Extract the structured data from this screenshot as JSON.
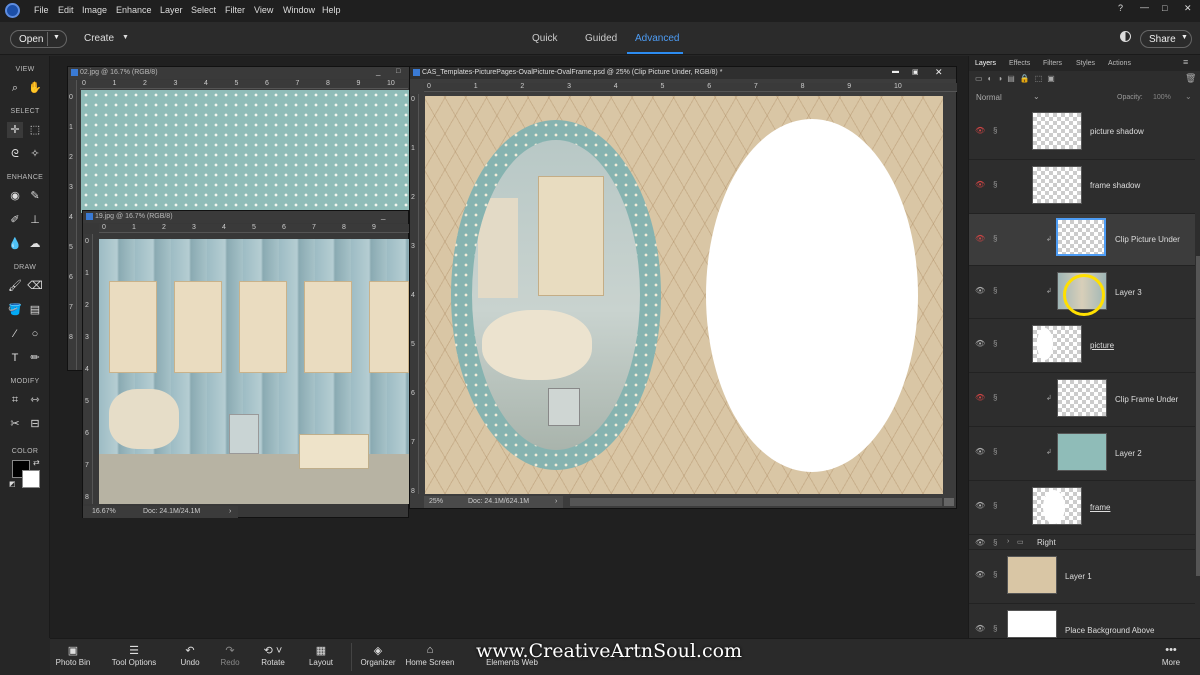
{
  "menubar": {
    "items": [
      "File",
      "Edit",
      "Image",
      "Enhance",
      "Layer",
      "Select",
      "Filter",
      "View",
      "Window",
      "Help"
    ]
  },
  "optbar": {
    "open_label": "Open",
    "create_label": "Create",
    "modes": [
      "Quick",
      "Guided",
      "Advanced"
    ],
    "active_mode": "Advanced",
    "share_label": "Share"
  },
  "toolbox": {
    "sections": [
      "VIEW",
      "SELECT",
      "ENHANCE",
      "DRAW",
      "MODIFY",
      "COLOR"
    ]
  },
  "windows": {
    "w02": {
      "title": "02.jpg @ 16.7% (RGB/8)"
    },
    "w19": {
      "title": "19.jpg @ 16.7% (RGB/8)",
      "zoom": "16.67%",
      "doc": "Doc: 24.1M/24.1M"
    },
    "main": {
      "title": "CAS_Templates-PicturePages-OvalPicture-OvalFrame.psd @ 25% (Clip Picture Under, RGB/8) *",
      "zoom": "25%",
      "doc": "Doc: 24.1M/624.1M"
    }
  },
  "rulers": {
    "h02": [
      "0",
      "1",
      "2",
      "3",
      "4",
      "5",
      "6",
      "7",
      "8",
      "9",
      "10"
    ],
    "v02": [
      "0",
      "1",
      "2",
      "3",
      "4",
      "5",
      "6",
      "7",
      "8"
    ],
    "h19": [
      "0",
      "1",
      "2",
      "3",
      "4",
      "5",
      "6",
      "7",
      "8",
      "9"
    ],
    "v19": [
      "0",
      "1",
      "2",
      "3",
      "4",
      "5",
      "6",
      "7",
      "8"
    ],
    "hmain": [
      "0",
      "1",
      "2",
      "3",
      "4",
      "5",
      "6",
      "7",
      "8",
      "9",
      "10"
    ],
    "vmain": [
      "0",
      "1",
      "2",
      "3",
      "4",
      "5",
      "6",
      "7",
      "8"
    ]
  },
  "panel": {
    "tabs": [
      "Layers",
      "Effects",
      "Filters",
      "Styles",
      "Actions"
    ],
    "active_tab": "Layers",
    "blend_mode": "Normal",
    "opacity_label": "Opacity:",
    "opacity_value": "100%",
    "layers": [
      {
        "name": "picture shadow"
      },
      {
        "name": "frame shadow"
      },
      {
        "name": "Clip Picture Under"
      },
      {
        "name": "Layer 3"
      },
      {
        "name": "picture"
      },
      {
        "name": "Clip Frame Under"
      },
      {
        "name": "Layer 2"
      },
      {
        "name": "frame"
      },
      {
        "name": "Right"
      },
      {
        "name": "Layer 1"
      },
      {
        "name": "Place Background Above"
      }
    ]
  },
  "bottombar": {
    "items": [
      "Photo Bin",
      "Tool Options",
      "Undo",
      "Redo",
      "Rotate",
      "Layout",
      "Organizer",
      "Home Screen",
      "Elements Web",
      "More"
    ]
  },
  "watermark": "www.CreativeArtnSoul.com",
  "colors": {
    "accent": "#2d8cf0",
    "teal": "#8fbcb8",
    "cream": "#d9c6a5",
    "selection_ring": "#ffe000"
  }
}
